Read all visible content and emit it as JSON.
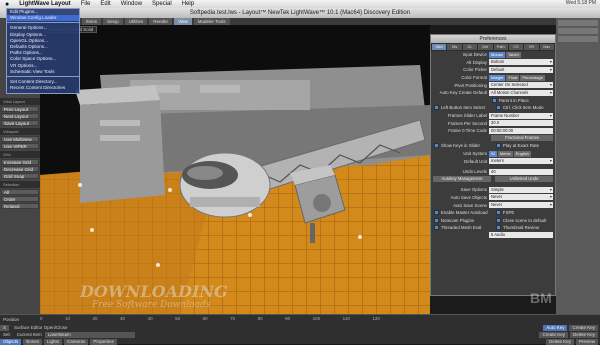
{
  "mac_menu": {
    "app": "LightWave Layout",
    "items": [
      "File",
      "Edit",
      "Window",
      "Special",
      "Help"
    ],
    "status": "Wed 5:18 PM"
  },
  "window_title": "Softpedia test.lws - Layout™ NewTek LightWave™ 10.1 (Mac64) Discovery Edition",
  "top_tabs": [
    {
      "label": "Items"
    },
    {
      "label": "Setup"
    },
    {
      "label": "Utilities"
    },
    {
      "label": "Render"
    },
    {
      "label": "View",
      "active": true
    },
    {
      "label": "Modeler Tools"
    }
  ],
  "dropdown_menu": [
    {
      "label": "Edit Plugins..."
    },
    {
      "label": "Window Config Loader",
      "selected": true
    },
    {
      "label": ""
    },
    {
      "label": "General Options..."
    },
    {
      "label": "Display Options..."
    },
    {
      "label": "OpenGL Options..."
    },
    {
      "label": "Defaults Options..."
    },
    {
      "label": "Paths Options..."
    },
    {
      "label": "Color Space Options..."
    },
    {
      "label": "VR Options..."
    },
    {
      "label": "Schematic View Tools"
    },
    {
      "label": ""
    },
    {
      "label": "Set Content Directory..."
    },
    {
      "label": "Recent Content Directories"
    }
  ],
  "viewport_label": "Textured Shaded Solid",
  "left_panel": {
    "layout_head": "View Layout",
    "layout_buttons": [
      "Prev Layout",
      "Next Layout",
      "Save Layout"
    ],
    "shading_head": "Viewport",
    "shading_buttons": [
      "Use Multiview",
      "Use VIPER"
    ],
    "grid_head": "Grid",
    "grid_buttons": [
      "Increase Grid",
      "Decrease Grid",
      "Grid Snap"
    ],
    "sel_head": "Selection",
    "sel_buttons": [
      "All",
      "Order",
      "Related"
    ]
  },
  "preferences": {
    "title": "Preferences",
    "tabs": [
      {
        "label": "Gen",
        "active": true
      },
      {
        "label": "Dis"
      },
      {
        "label": "GL"
      },
      {
        "label": "Def"
      },
      {
        "label": "Path"
      },
      {
        "label": "CS"
      },
      {
        "label": "VR"
      },
      {
        "label": "Nav"
      }
    ],
    "rows": [
      {
        "kind": "btns",
        "label": "Input Device",
        "buttons": [
          "Mouse",
          "Tablet"
        ]
      },
      {
        "kind": "dd",
        "label": "Alt Display",
        "value": "Bottom"
      },
      {
        "kind": "dd",
        "label": "Color Picker",
        "value": "Default"
      },
      {
        "kind": "btns",
        "label": "Color Format",
        "buttons": [
          "Integer",
          "Float",
          "Percentage"
        ]
      },
      {
        "kind": "dd",
        "label": "Pivot Positioning",
        "value": "Center On Selected"
      },
      {
        "kind": "dd",
        "label": "Auto Key Create Default",
        "value": "All Motion Channels"
      },
      {
        "kind": "chk",
        "label": "",
        "text": "Parent in Place"
      },
      {
        "kind": "chk2",
        "text1": "Left Button Item Select",
        "text2": "Ctrl. Click Item Mode"
      },
      {
        "kind": "dd",
        "label": "Frames Slider Label",
        "value": "Frame Number"
      },
      {
        "kind": "val",
        "label": "Frames Per Second",
        "value": "30.0"
      },
      {
        "kind": "val",
        "label": "Frame 0 Time Code",
        "value": "00:00:00:00"
      },
      {
        "kind": "wide",
        "label": "",
        "value": "Fractional Frames"
      },
      {
        "kind": "chk2",
        "text1": "Show Keys in Slider",
        "text2": "Play at Exact Rate"
      },
      {
        "kind": "btns",
        "label": "Unit System",
        "buttons": [
          "SI",
          "Metric",
          "English"
        ]
      },
      {
        "kind": "dd",
        "label": "Default Unit",
        "value": "meters"
      },
      {
        "kind": "sep"
      },
      {
        "kind": "val",
        "label": "Undo Levels",
        "value": "40"
      },
      {
        "kind": "wide2",
        "v1": "Autokey Management",
        "v2": "Unlimited Undo"
      },
      {
        "kind": "sep"
      },
      {
        "kind": "dd",
        "label": "Save Options",
        "value": "Simple"
      },
      {
        "kind": "dd",
        "label": "Auto Save Objects",
        "value": "Never"
      },
      {
        "kind": "dd",
        "label": "Auto Save Scene",
        "value": "Never"
      },
      {
        "kind": "chk2",
        "text1": "Enable Master Autoload",
        "text2": "FSPE"
      },
      {
        "kind": "chk2",
        "text1": "Notecam Plugins",
        "text2": "Close scene to default"
      },
      {
        "kind": "chk2",
        "text1": "Threaded Mesh Eval",
        "text2": "Thumbnail Review"
      },
      {
        "kind": "val",
        "label": "",
        "value": "5 Audio"
      }
    ]
  },
  "timeline": {
    "frame_label": "Position",
    "ticks": [
      "0",
      "10",
      "20",
      "30",
      "40",
      "50",
      "60",
      "70",
      "80",
      "90",
      "100",
      "110",
      "120"
    ],
    "row1": {
      "left": "S",
      "current": "Surface Editor Open/Close",
      "right_btns": [
        "Auto Key",
        "Create Key"
      ]
    },
    "row2": {
      "sel_label": "Sel:",
      "current_item": "Current Item",
      "item_value": "LaserBeam",
      "right_btns": [
        "Create Key",
        "Delete Key"
      ]
    },
    "row3": {
      "buttons": [
        "Objects",
        "Bones",
        "Lights",
        "Cameras",
        "Properties"
      ],
      "right_btns": [
        "Delete Key",
        "Preview"
      ]
    }
  },
  "watermarks": {
    "main": "DOWNLOADING",
    "sub": "Free Software Downloads",
    "corner": "BM"
  },
  "colors": {
    "accent": "#5d86c8",
    "floor": "#d4891b"
  }
}
